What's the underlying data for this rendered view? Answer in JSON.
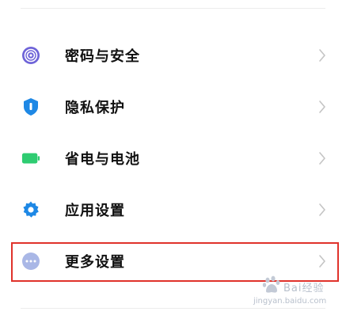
{
  "settings": {
    "items": [
      {
        "label": "密码与安全",
        "icon": "fingerprint-icon",
        "icon_color": "#6e63d8"
      },
      {
        "label": "隐私保护",
        "icon": "shield-icon",
        "icon_color": "#1e88e5"
      },
      {
        "label": "省电与电池",
        "icon": "battery-icon",
        "icon_color": "#2ecc71"
      },
      {
        "label": "应用设置",
        "icon": "gear-icon",
        "icon_color": "#1e88e5"
      },
      {
        "label": "更多设置",
        "icon": "more-dots-icon",
        "icon_color": "#a9b7e6"
      }
    ]
  },
  "highlight": {
    "color": "#e0322b",
    "target": "更多设置"
  },
  "watermark": {
    "text": "Bai经验",
    "url": "jingyan.baidu.com"
  }
}
